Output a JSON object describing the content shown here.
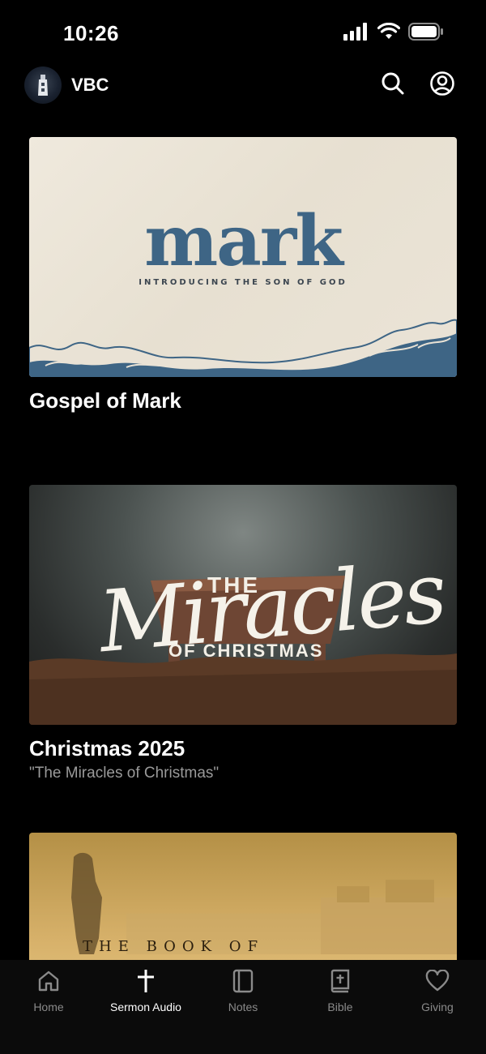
{
  "status": {
    "time": "10:26"
  },
  "header": {
    "title": "VBC"
  },
  "series": [
    {
      "title": "Gospel of Mark",
      "subtitle": "",
      "art_word": "mark",
      "art_tagline": "INTRODUCING THE SON OF GOD"
    },
    {
      "title": "Christmas 2025",
      "subtitle": "\"The Miracles of Christmas\"",
      "art_the": "THE",
      "art_script": "Miracles",
      "art_of": "OF CHRISTMAS"
    },
    {
      "title": "",
      "subtitle": "",
      "art_text": "THE BOOK OF"
    }
  ],
  "tabs": [
    {
      "label": "Home",
      "icon": "home-icon"
    },
    {
      "label": "Sermon Audio",
      "icon": "cross-icon"
    },
    {
      "label": "Notes",
      "icon": "notes-icon"
    },
    {
      "label": "Bible",
      "icon": "bible-icon"
    },
    {
      "label": "Giving",
      "icon": "heart-icon"
    }
  ],
  "active_tab": "Sermon Audio",
  "colors": {
    "background": "#000000",
    "active_tab": "#ffffff",
    "inactive_tab": "#8a8a8a",
    "subtitle": "#9a9a9a",
    "mark_blue": "#3e6585"
  }
}
